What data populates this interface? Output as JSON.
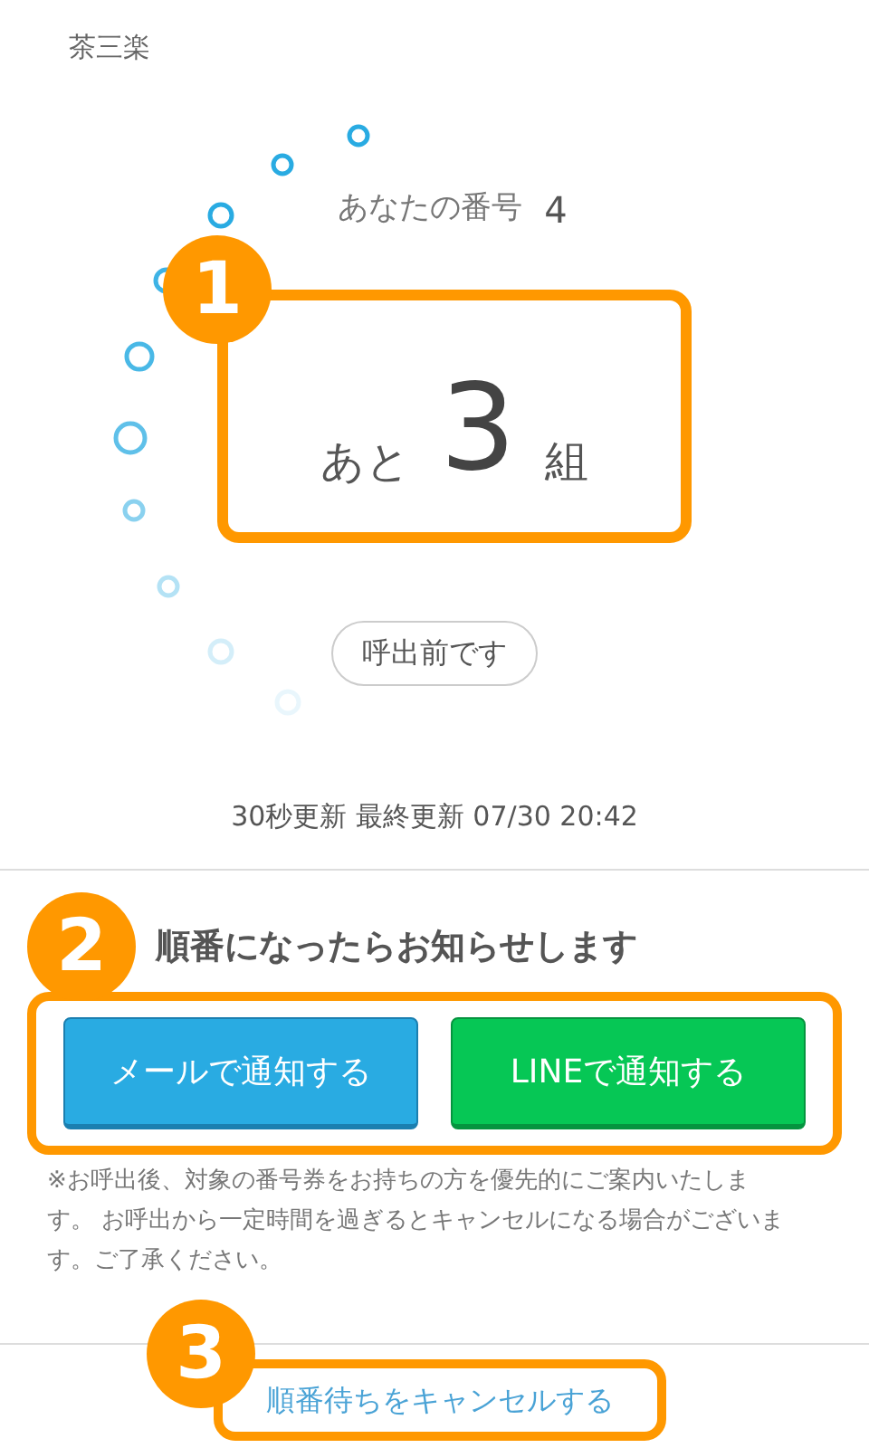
{
  "header": {
    "store_name": "茶三楽"
  },
  "queue": {
    "callout": "1",
    "your_number_label": "あなたの番号",
    "your_number": "4",
    "remaining_prefix": "あと",
    "remaining_count": "3",
    "remaining_suffix": "組",
    "status_badge": "呼出前です",
    "update_info": "30秒更新 最終更新 07/30 20:42"
  },
  "notify": {
    "callout": "2",
    "heading": "順番になったらお知らせします",
    "buttons": [
      {
        "label": "メールで通知する",
        "kind": "mail"
      },
      {
        "label": "LINEで通知する",
        "kind": "line"
      }
    ],
    "note": "※お呼出後、対象の番号券をお持ちの方を優先的にご案内いたします。 お呼出から一定時間を過ぎるとキャンセルになる場合がございます。ご了承ください。"
  },
  "cancel": {
    "callout": "3",
    "link": "順番待ちをキャンセルする"
  }
}
